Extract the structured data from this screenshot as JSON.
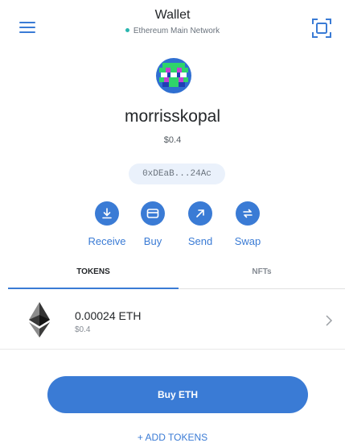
{
  "header": {
    "title": "Wallet",
    "network": "Ethereum Main Network",
    "network_dot_color": "#29b6af",
    "menu_icon": "hamburger-icon",
    "scan_icon": "qr-scan-icon"
  },
  "account": {
    "name": "morrisskopal",
    "balance": "$0.4",
    "address": "0xDEaB...24Ac"
  },
  "actions": [
    {
      "label": "Receive",
      "icon": "download-icon"
    },
    {
      "label": "Buy",
      "icon": "card-icon"
    },
    {
      "label": "Send",
      "icon": "arrow-up-right-icon"
    },
    {
      "label": "Swap",
      "icon": "swap-icon"
    }
  ],
  "tabs": [
    {
      "label": "TOKENS",
      "active": true
    },
    {
      "label": "NFTs",
      "active": false
    }
  ],
  "tokens": [
    {
      "amount": "0.00024 ETH",
      "fiat": "$0.4",
      "icon": "ethereum-icon"
    }
  ],
  "buy_button_label": "Buy ETH",
  "add_tokens_label": "+ ADD TOKENS",
  "colors": {
    "accent": "#3a7bd5",
    "text": "#24272a",
    "muted": "#858b93"
  }
}
